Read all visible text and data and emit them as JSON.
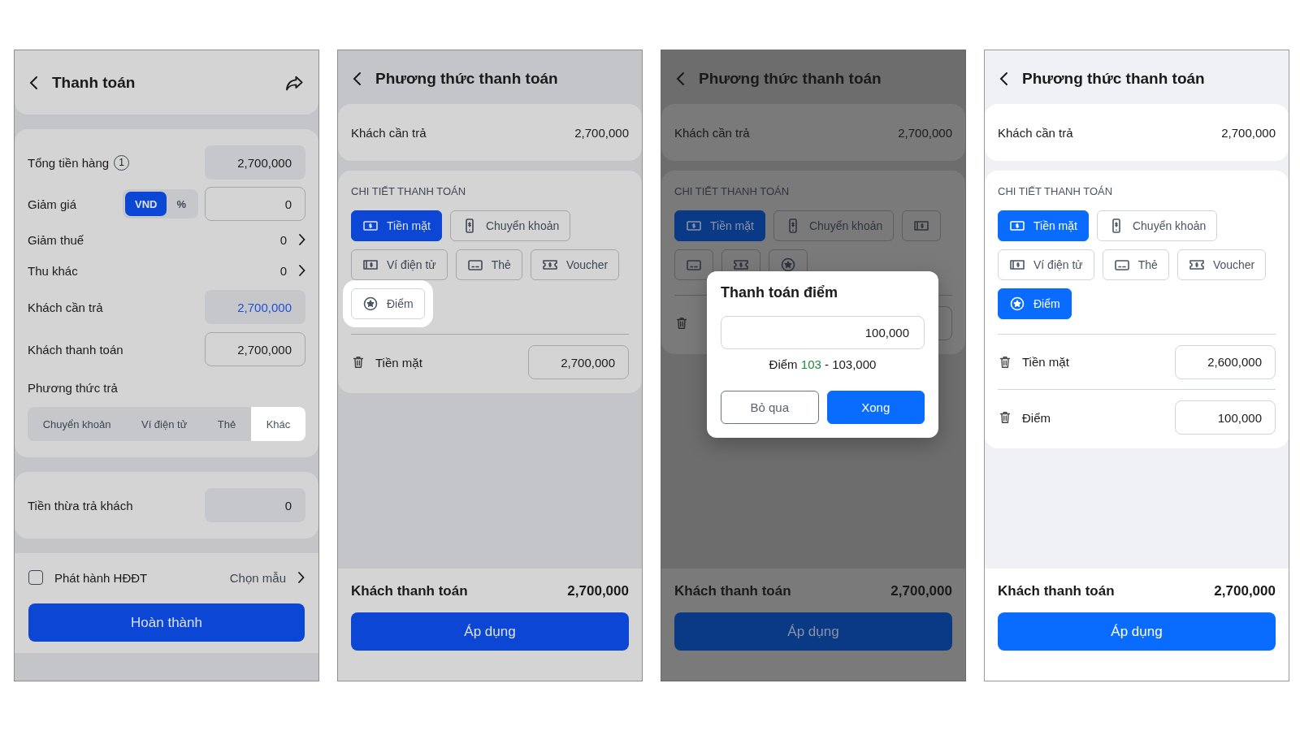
{
  "screens": [
    {
      "kind": "checkout",
      "dimmed": true,
      "title": "Thanh toán",
      "rows": [
        {
          "kind": "readonly",
          "label": "Tổng tiền hàng",
          "info": "1",
          "value": "2,700,000"
        },
        {
          "kind": "discount",
          "label": "Giảm giá",
          "units": [
            {
              "label": "VND",
              "selected": true
            },
            {
              "label": "%",
              "selected": false
            }
          ],
          "value": "0"
        },
        {
          "kind": "link",
          "label": "Giảm thuế",
          "value": "0"
        },
        {
          "kind": "link",
          "label": "Thu khác",
          "value": "0"
        },
        {
          "kind": "highlight",
          "label": "Khách cần trả",
          "value": "2,700,000"
        },
        {
          "kind": "input",
          "label": "Khách thanh toán",
          "value": "2,700,000"
        }
      ],
      "method": {
        "label": "Phương thức trả",
        "tabs": [
          {
            "label": "Chuyển khoản",
            "selected": false,
            "highlighted": false
          },
          {
            "label": "Ví điện tử",
            "selected": false,
            "highlighted": false
          },
          {
            "label": "Thẻ",
            "selected": false,
            "highlighted": false
          },
          {
            "label": "Khác",
            "selected": true,
            "highlighted": true
          }
        ]
      },
      "change": {
        "label": "Tiền thừa trả khách",
        "value": "0"
      },
      "invoice": {
        "checked": false,
        "label": "Phát hành HĐĐT",
        "link": "Chọn mẫu"
      },
      "button": "Hoàn thành"
    },
    {
      "kind": "methods",
      "dimmed": true,
      "title": "Phương thức thanh toán",
      "due": {
        "label": "Khách cần trả",
        "value": "2,700,000"
      },
      "section": "CHI TIẾT THANH TOÁN",
      "chips": [
        {
          "kind": "cash",
          "label": "Tiền mặt",
          "selected": true,
          "highlighted": false
        },
        {
          "kind": "transfer",
          "label": "Chuyển khoản",
          "selected": false,
          "highlighted": false
        },
        {
          "kind": "wallet",
          "label": "Ví điện tử",
          "selected": false,
          "highlighted": false
        },
        {
          "kind": "card",
          "label": "Thẻ",
          "selected": false,
          "highlighted": false
        },
        {
          "kind": "voucher",
          "label": "Voucher",
          "selected": false,
          "highlighted": false
        },
        {
          "kind": "points",
          "label": "Điểm",
          "selected": false,
          "highlighted": true
        }
      ],
      "lines": [
        {
          "kind": "amount",
          "label": "Tiền mặt",
          "value": "2,700,000"
        }
      ],
      "total": {
        "label": "Khách thanh toán",
        "value": "2,700,000"
      },
      "button": "Áp dụng"
    },
    {
      "kind": "methods",
      "dimmed": true,
      "title": "Phương thức thanh toán",
      "due": {
        "label": "Khách cần trả",
        "value": "2,700,000"
      },
      "section": "CHI TIẾT THANH TOÁN",
      "chips": [
        {
          "kind": "cash",
          "label": "Tiền mặt",
          "selected": true,
          "highlighted": false
        },
        {
          "kind": "transfer",
          "label": "Chuyển khoản",
          "selected": false,
          "highlighted": false
        },
        {
          "kind": "wallet",
          "selected": false,
          "highlighted": false
        },
        {
          "kind": "card",
          "selected": false,
          "highlighted": false
        },
        {
          "kind": "voucher",
          "selected": false,
          "highlighted": false
        },
        {
          "kind": "points",
          "selected": false,
          "highlighted": false
        }
      ],
      "lines": [
        {
          "kind": "covered"
        }
      ],
      "total": {
        "label": "Khách thanh toán",
        "value": "2,700,000"
      },
      "button": "Áp dụng",
      "dialog": {
        "title": "Thanh toán điểm",
        "value": "100,000",
        "note": {
          "prefix": "Điểm",
          "points": "103",
          "suffix": "- 103,000"
        },
        "buttons": [
          {
            "label": "Bỏ qua",
            "kind": "secondary"
          },
          {
            "label": "Xong",
            "kind": "primary"
          }
        ]
      }
    },
    {
      "kind": "methods",
      "dimmed": false,
      "title": "Phương thức thanh toán",
      "due": {
        "label": "Khách cần trả",
        "value": "2,700,000"
      },
      "section": "CHI TIẾT THANH TOÁN",
      "chips": [
        {
          "kind": "cash",
          "label": "Tiền mặt",
          "selected": true
        },
        {
          "kind": "transfer",
          "label": "Chuyển khoản",
          "selected": false
        },
        {
          "kind": "wallet",
          "label": "Ví điện tử",
          "selected": false
        },
        {
          "kind": "card",
          "label": "Thẻ",
          "selected": false
        },
        {
          "kind": "voucher",
          "label": "Voucher",
          "selected": false
        },
        {
          "kind": "points",
          "label": "Điểm",
          "selected": true
        }
      ],
      "lines": [
        {
          "kind": "amount",
          "label": "Tiền mặt",
          "value": "2,600,000"
        },
        {
          "kind": "amount",
          "label": "Điểm",
          "value": "100,000"
        }
      ],
      "total": {
        "label": "Khách thanh toán",
        "value": "2,700,000"
      },
      "button": "Áp dụng"
    }
  ]
}
